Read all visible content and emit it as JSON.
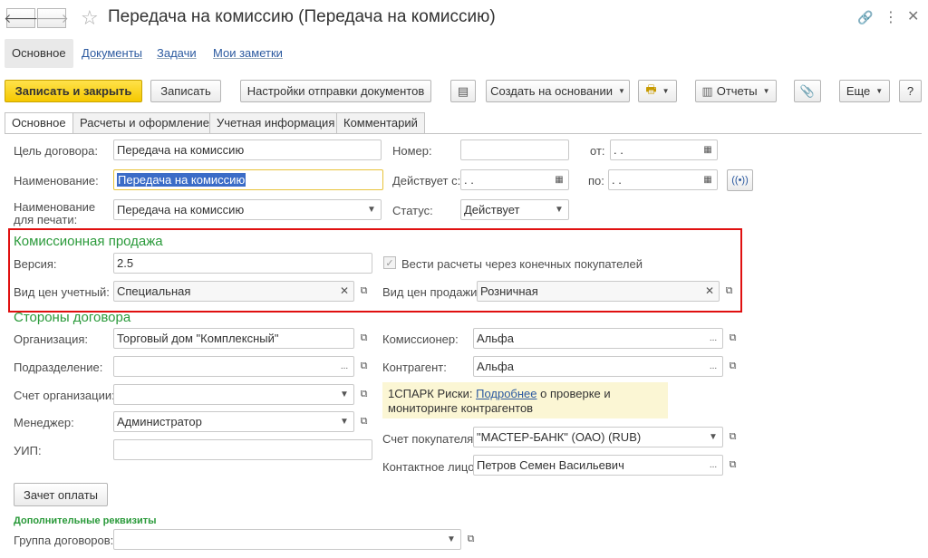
{
  "window": {
    "title": "Передача на комиссию (Передача на комиссию)",
    "back_icon": "🡐",
    "forward_icon": "🡒"
  },
  "top_tabs": [
    {
      "label": "Основное"
    },
    {
      "label": "Документы"
    },
    {
      "label": "Задачи"
    },
    {
      "label": "Мои заметки"
    }
  ],
  "toolbar": {
    "save_close": "Записать и закрыть",
    "save": "Записать",
    "send_settings": "Настройки отправки документов",
    "create_based": "Создать на основании",
    "reports": "Отчеты",
    "more": "Еще",
    "help": "?"
  },
  "form_tabs": [
    {
      "label": "Основное"
    },
    {
      "label": "Расчеты и оформление"
    },
    {
      "label": "Учетная информация"
    },
    {
      "label": "Комментарий"
    }
  ],
  "fields": {
    "goal_label": "Цель договора:",
    "goal_value": "Передача на комиссию",
    "name_label": "Наименование:",
    "name_value": "Передача на комиссию",
    "print_name_label_1": "Наименование",
    "print_name_label_2": "для печати:",
    "print_name_value": "Передача на комиссию",
    "number_label": "Номер:",
    "number_value": "",
    "from_label": "от:",
    "from_value": " .  .",
    "valid_label": "Действует с:",
    "valid_value": " .  .",
    "to_label": "по:",
    "to_value": " .  .",
    "status_label": "Статус:",
    "status_value": "Действует"
  },
  "commission": {
    "title": "Комиссионная продажа",
    "version_label": "Версия:",
    "version_value": "2.5",
    "checkbox_label": "Вести расчеты через конечных покупателей",
    "acc_price_label": "Вид цен учетный:",
    "acc_price_value": "Специальная",
    "sale_price_label": "Вид цен продажи:",
    "sale_price_value": "Розничная"
  },
  "parties": {
    "title": "Стороны договора",
    "org_label": "Организация:",
    "org_value": "Торговый дом \"Комплексный\"",
    "dept_label": "Подразделение:",
    "dept_value": "",
    "account_label": "Счет организации:",
    "account_value": "",
    "manager_label": "Менеджер:",
    "manager_value": "Администратор",
    "uip_label": "УИП:",
    "uip_value": "",
    "commissioner_label": "Комиссионер:",
    "commissioner_value": "Альфа",
    "counterparty_label": "Контрагент:",
    "counterparty_value": "Альфа",
    "spark_prefix": "1СПАРК Риски: ",
    "spark_link": "Подробнее",
    "spark_suffix": " о проверке и",
    "spark_line2": "мониторинге контрагентов",
    "buyer_account_label": "Счет покупателя:",
    "buyer_account_value": "\"МАСТЕР-БАНК\" (ОАО) (RUB)",
    "contact_label": "Контактное лицо:",
    "contact_value": "Петров Семен Васильевич"
  },
  "payment_button": "Зачет оплаты",
  "extra": {
    "title": "Дополнительные реквизиты",
    "group_label": "Группа договоров:",
    "group_value": ""
  }
}
